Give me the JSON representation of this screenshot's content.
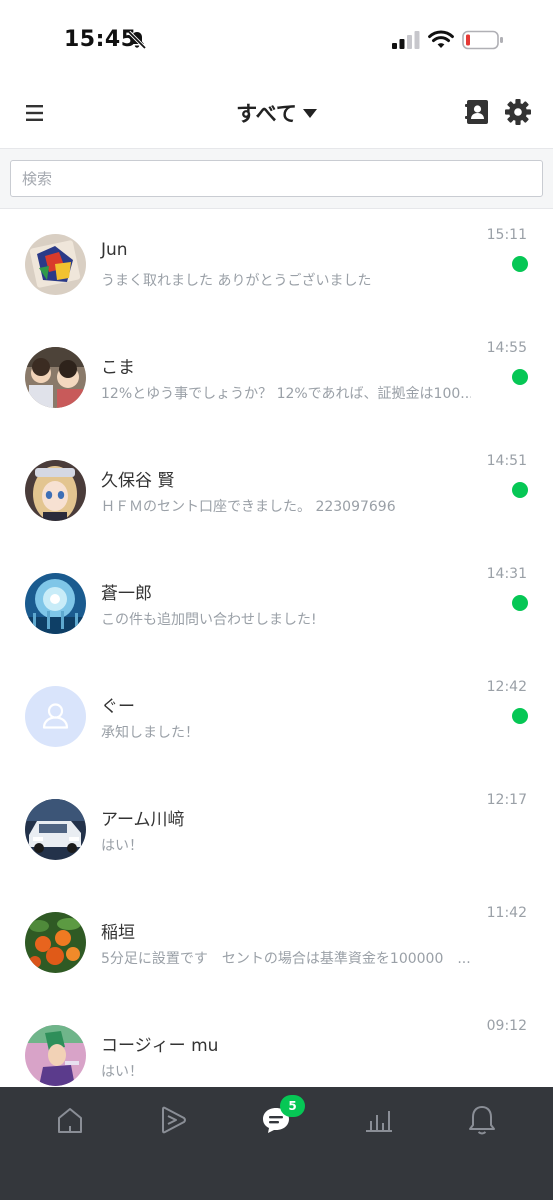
{
  "status_bar": {
    "time": "15:45",
    "icons": [
      "mute-bell-icon",
      "cellular-signal-icon",
      "wifi-icon",
      "low-battery-icon"
    ],
    "battery_color": "#e53935"
  },
  "header": {
    "title": "すべて",
    "icons": [
      "hamburger-menu-icon",
      "contacts-icon",
      "gear-icon"
    ]
  },
  "search": {
    "placeholder": "検索"
  },
  "chats": [
    {
      "name": "Jun",
      "preview": "うまく取れました ありがとうございました",
      "time": "15:11",
      "unread": true,
      "avatar": "photo"
    },
    {
      "name": "こま",
      "preview": "12%とゆう事でしょうか？ 12%であれば、証拠金は100...",
      "time": "14:55",
      "unread": true,
      "avatar": "photo"
    },
    {
      "name": "久保谷 賢",
      "preview": "ＨＦＭのセント口座できました。 223097696",
      "time": "14:51",
      "unread": true,
      "avatar": "photo"
    },
    {
      "name": "蒼一郎",
      "preview": "この件も追加問い合わせしました!",
      "time": "14:31",
      "unread": true,
      "avatar": "photo"
    },
    {
      "name": "ぐー",
      "preview": "承知しました！",
      "time": "12:42",
      "unread": true,
      "avatar": "default-user-icon"
    },
    {
      "name": "アーム川﨑",
      "preview": "はい！",
      "time": "12:17",
      "unread": false,
      "avatar": "photo"
    },
    {
      "name": "稲垣",
      "preview": "5分足に設置です　セントの場合は基準資金を100000　...",
      "time": "11:42",
      "unread": false,
      "avatar": "photo"
    },
    {
      "name": "コージィー mu",
      "preview": "はい！",
      "time": "09:12",
      "unread": false,
      "avatar": "photo"
    }
  ],
  "bottom_nav": {
    "items": [
      "home-icon",
      "play-icon",
      "chat-icon",
      "chart-icon",
      "bell-icon"
    ],
    "active": "chat-icon",
    "chat_badge": "5"
  },
  "colors": {
    "accent_green": "#06c755",
    "nav_background": "#34373c"
  }
}
